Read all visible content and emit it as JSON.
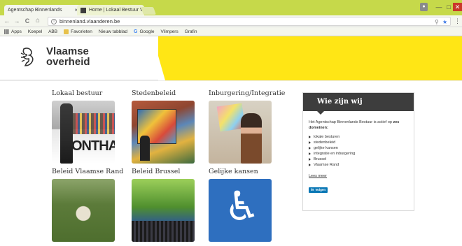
{
  "browser": {
    "tabs": [
      {
        "title": "Agentschap Binnenlands ",
        "active": true
      },
      {
        "title": "Home | Lokaal Bestuur V",
        "active": false
      }
    ],
    "tab_close": "×",
    "address": "binnenland.vlaanderen.be",
    "nav": {
      "back": "←",
      "forward": "→",
      "reload": "C",
      "home": "⌂"
    },
    "bookmarks": [
      "Apps",
      "Koepel",
      "ABB",
      "Favorieten",
      "Nieuw tabblad",
      "Google",
      "Vlimpers",
      "Grafin"
    ]
  },
  "header": {
    "logo_line1": "Vlaamse",
    "logo_line2": "overheid",
    "accent_color": "#ffe615"
  },
  "tiles": [
    {
      "title": "Lokaal bestuur"
    },
    {
      "title": "Stedenbeleid"
    },
    {
      "title": "Inburgering/Integratie"
    },
    {
      "title": "Beleid Vlaamse Rand"
    },
    {
      "title": "Beleid Brussel"
    },
    {
      "title": "Gelijke kansen"
    }
  ],
  "tile_image_text": "ONTHAA",
  "sidebar": {
    "title": "Wie zijn wij",
    "intro": "Het Agentschap Binnenlands Bestuur is actief op",
    "intro_bold": "zes domeinen:",
    "domains": [
      "lokale besturen",
      "stedenbeleid",
      "gelijke kansen",
      "integratie en inburgering",
      "Brussel",
      "Vlaamse Rand"
    ],
    "read_more": "Lees meer",
    "linkedin_label": "Volgen",
    "linkedin_icon": "in"
  }
}
